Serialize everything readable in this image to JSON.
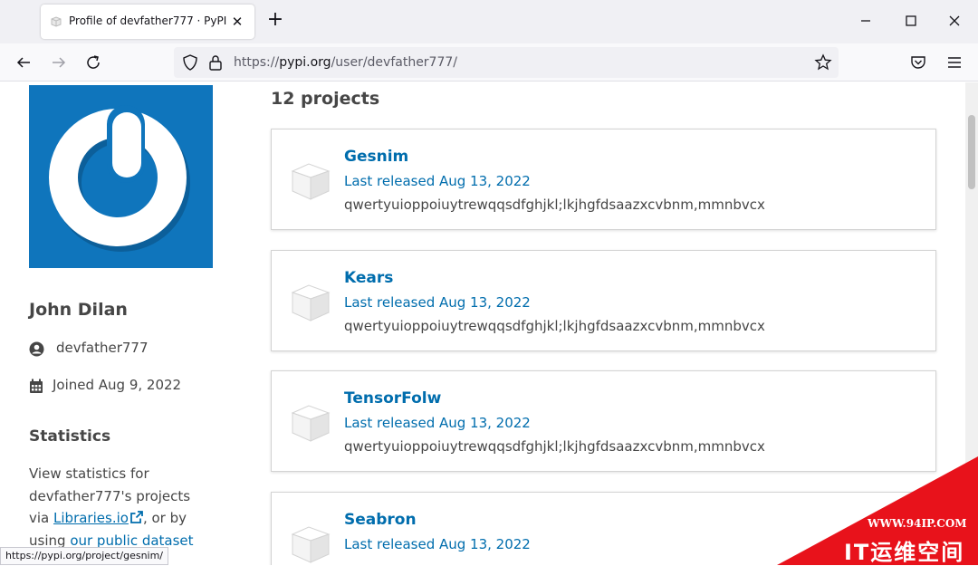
{
  "browser": {
    "tab_title": "Profile of devfather777 · PyPI",
    "tab_close": "✕",
    "new_tab": "+",
    "url_prefix": "https://",
    "url_host": "pypi.org",
    "url_path": "/user/devfather777/",
    "status_url": "https://pypi.org/project/gesnim/"
  },
  "profile": {
    "name": "John Dilan",
    "username": "devfather777",
    "joined": "Joined Aug 9, 2022",
    "stats_heading": "Statistics",
    "stats_text_1": "View statistics for devfather777's projects via",
    "stats_link_1": "Libraries.io",
    "stats_text_2": ", or by using",
    "stats_link_2": "our public dataset on"
  },
  "projects_heading": "12 projects",
  "projects": [
    {
      "name": "Gesnim",
      "released": "Last released Aug 13, 2022",
      "description": "qwertyuioppoiuytrewqqsdfghjkl;lkjhgfdsaazxcvbnm,mmnbvcx"
    },
    {
      "name": "Kears",
      "released": "Last released Aug 13, 2022",
      "description": "qwertyuioppoiuytrewqqsdfghjkl;lkjhgfdsaazxcvbnm,mmnbvcx"
    },
    {
      "name": "TensorFolw",
      "released": "Last released Aug 13, 2022",
      "description": "qwertyuioppoiuytrewqqsdfghjkl;lkjhgfdsaazxcvbnm,mmnbvcx"
    },
    {
      "name": "Seabron",
      "released": "Last released Aug 13, 2022",
      "description": ""
    }
  ],
  "watermark": {
    "url": "WWW.94IP.COM",
    "name": "IT运维空间"
  },
  "colors": {
    "pypi_blue": "#0f75bc",
    "link_blue": "#006dad",
    "text": "#464646",
    "watermark_red": "#e8121b"
  }
}
